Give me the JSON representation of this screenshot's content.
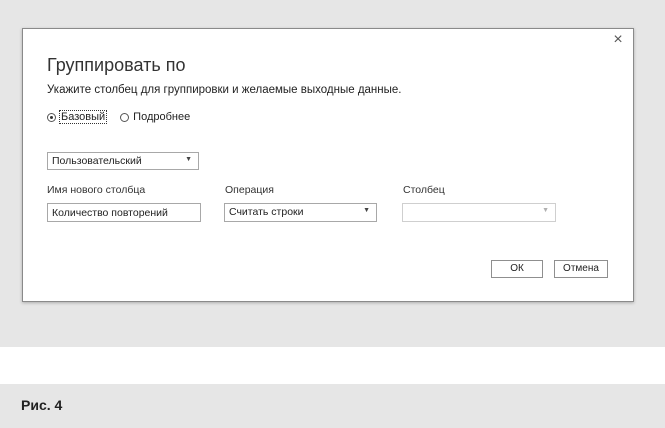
{
  "dialog": {
    "title": "Группировать по",
    "subtitle": "Укажите столбец для группировки и желаемые выходные данные.",
    "close_icon": "×",
    "radio_options": [
      {
        "label": "Базовый",
        "checked": true
      },
      {
        "label": "Подробнее",
        "checked": false
      }
    ],
    "group_by_select": {
      "value": "Пользовательский",
      "caret": "▼"
    },
    "columns": {
      "new_column_label": "Имя нового столбца",
      "operation_label": "Операция",
      "column_label": "Столбец"
    },
    "new_column_input": {
      "value": "Количество повторений"
    },
    "operation_select": {
      "value": "Считать строки",
      "caret": "▼"
    },
    "column_select": {
      "value": "",
      "caret": "▼",
      "disabled": true
    },
    "buttons": {
      "ok": "ОК",
      "cancel": "Отмена"
    }
  },
  "caption": "Рис. 4"
}
